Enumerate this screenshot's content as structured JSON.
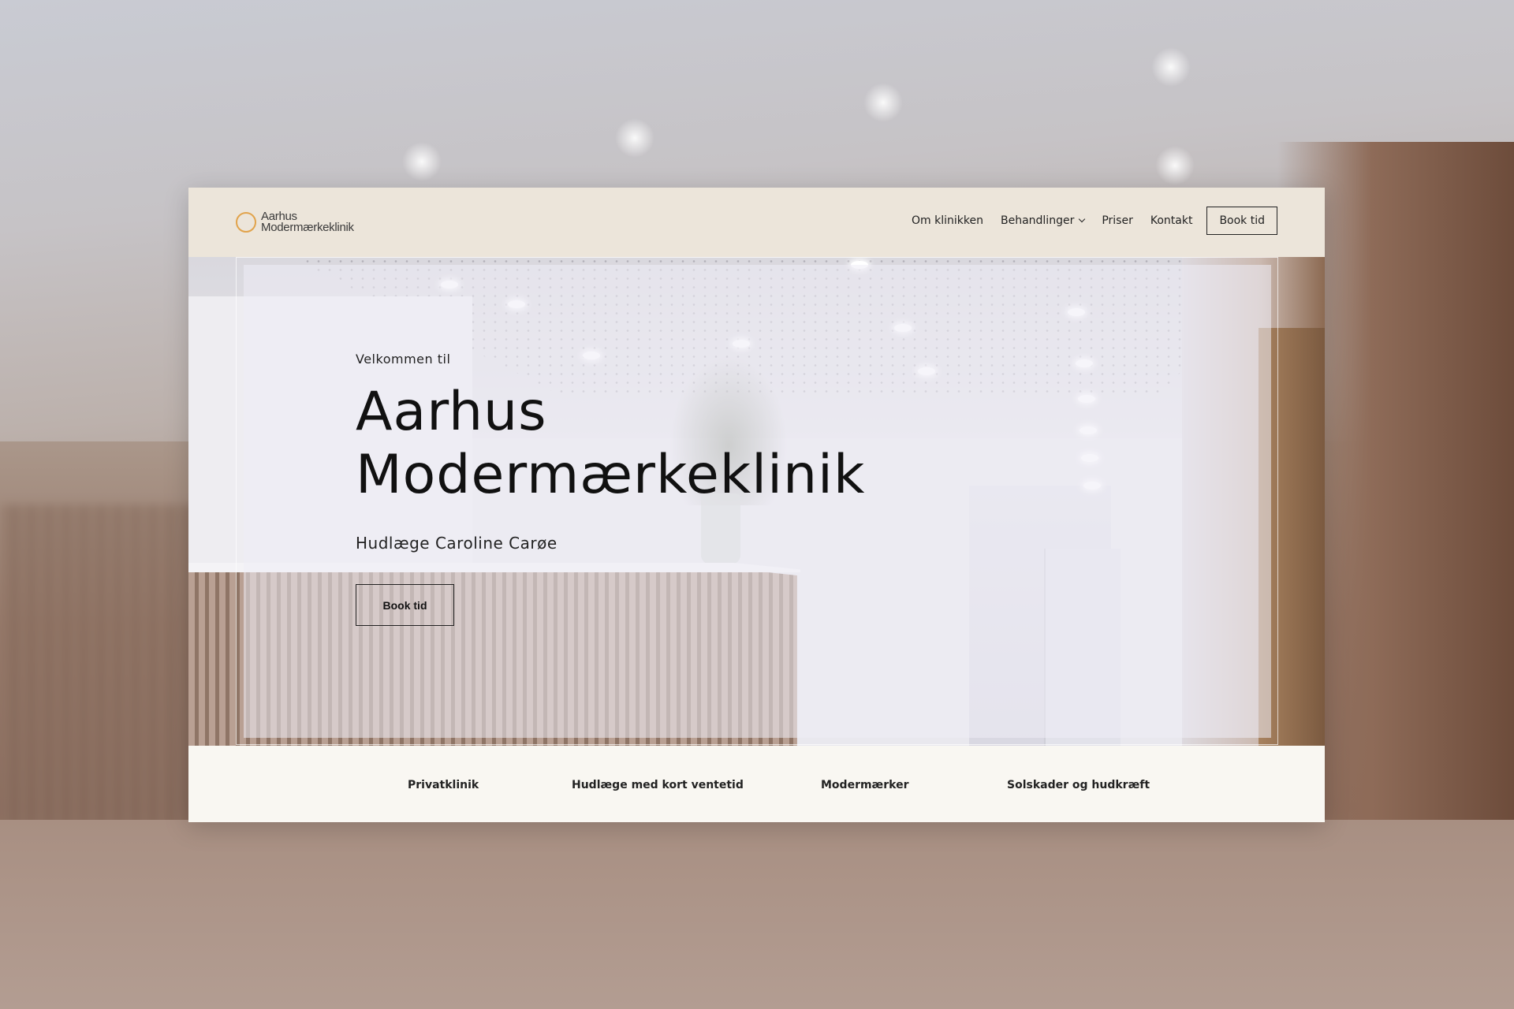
{
  "header": {
    "logo_line1": "Aarhus",
    "logo_line2": "Modermærkeklinik",
    "nav": [
      {
        "label": "Om klinikken"
      },
      {
        "label": "Behandlinger"
      },
      {
        "label": "Priser"
      },
      {
        "label": "Kontakt"
      }
    ],
    "book_button": "Book tid"
  },
  "hero": {
    "welcome": "Velkommen til",
    "title_line1": "Aarhus",
    "title_line2": "Modermærkeklinik",
    "subtitle": "Hudlæge Caroline Carøe",
    "button": "Book tid"
  },
  "strip": {
    "items": [
      {
        "label": "Privatklinik"
      },
      {
        "label": "Hudlæge med kort ventetid"
      },
      {
        "label": "Modermærker"
      },
      {
        "label": "Solskader og hudkræft"
      }
    ]
  },
  "colors": {
    "accent": "#e1a34b",
    "header_bg": "#ece5da",
    "strip_bg": "#f9f7f2",
    "text": "#111111"
  },
  "icons": {
    "logo": "circle-ring-icon",
    "dropdown": "chevron-down-icon"
  }
}
